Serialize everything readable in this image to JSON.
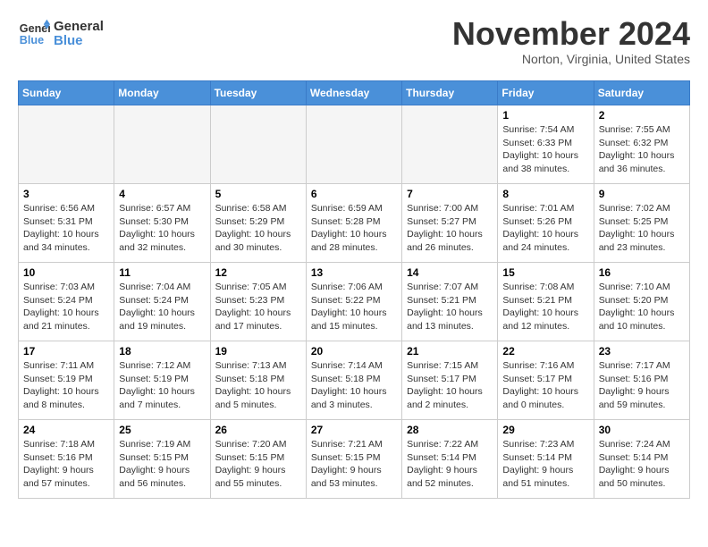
{
  "logo": {
    "line1": "General",
    "line2": "Blue"
  },
  "title": "November 2024",
  "location": "Norton, Virginia, United States",
  "days_header": [
    "Sunday",
    "Monday",
    "Tuesday",
    "Wednesday",
    "Thursday",
    "Friday",
    "Saturday"
  ],
  "weeks": [
    [
      {
        "num": "",
        "info": ""
      },
      {
        "num": "",
        "info": ""
      },
      {
        "num": "",
        "info": ""
      },
      {
        "num": "",
        "info": ""
      },
      {
        "num": "",
        "info": ""
      },
      {
        "num": "1",
        "info": "Sunrise: 7:54 AM\nSunset: 6:33 PM\nDaylight: 10 hours\nand 38 minutes."
      },
      {
        "num": "2",
        "info": "Sunrise: 7:55 AM\nSunset: 6:32 PM\nDaylight: 10 hours\nand 36 minutes."
      }
    ],
    [
      {
        "num": "3",
        "info": "Sunrise: 6:56 AM\nSunset: 5:31 PM\nDaylight: 10 hours\nand 34 minutes."
      },
      {
        "num": "4",
        "info": "Sunrise: 6:57 AM\nSunset: 5:30 PM\nDaylight: 10 hours\nand 32 minutes."
      },
      {
        "num": "5",
        "info": "Sunrise: 6:58 AM\nSunset: 5:29 PM\nDaylight: 10 hours\nand 30 minutes."
      },
      {
        "num": "6",
        "info": "Sunrise: 6:59 AM\nSunset: 5:28 PM\nDaylight: 10 hours\nand 28 minutes."
      },
      {
        "num": "7",
        "info": "Sunrise: 7:00 AM\nSunset: 5:27 PM\nDaylight: 10 hours\nand 26 minutes."
      },
      {
        "num": "8",
        "info": "Sunrise: 7:01 AM\nSunset: 5:26 PM\nDaylight: 10 hours\nand 24 minutes."
      },
      {
        "num": "9",
        "info": "Sunrise: 7:02 AM\nSunset: 5:25 PM\nDaylight: 10 hours\nand 23 minutes."
      }
    ],
    [
      {
        "num": "10",
        "info": "Sunrise: 7:03 AM\nSunset: 5:24 PM\nDaylight: 10 hours\nand 21 minutes."
      },
      {
        "num": "11",
        "info": "Sunrise: 7:04 AM\nSunset: 5:24 PM\nDaylight: 10 hours\nand 19 minutes."
      },
      {
        "num": "12",
        "info": "Sunrise: 7:05 AM\nSunset: 5:23 PM\nDaylight: 10 hours\nand 17 minutes."
      },
      {
        "num": "13",
        "info": "Sunrise: 7:06 AM\nSunset: 5:22 PM\nDaylight: 10 hours\nand 15 minutes."
      },
      {
        "num": "14",
        "info": "Sunrise: 7:07 AM\nSunset: 5:21 PM\nDaylight: 10 hours\nand 13 minutes."
      },
      {
        "num": "15",
        "info": "Sunrise: 7:08 AM\nSunset: 5:21 PM\nDaylight: 10 hours\nand 12 minutes."
      },
      {
        "num": "16",
        "info": "Sunrise: 7:10 AM\nSunset: 5:20 PM\nDaylight: 10 hours\nand 10 minutes."
      }
    ],
    [
      {
        "num": "17",
        "info": "Sunrise: 7:11 AM\nSunset: 5:19 PM\nDaylight: 10 hours\nand 8 minutes."
      },
      {
        "num": "18",
        "info": "Sunrise: 7:12 AM\nSunset: 5:19 PM\nDaylight: 10 hours\nand 7 minutes."
      },
      {
        "num": "19",
        "info": "Sunrise: 7:13 AM\nSunset: 5:18 PM\nDaylight: 10 hours\nand 5 minutes."
      },
      {
        "num": "20",
        "info": "Sunrise: 7:14 AM\nSunset: 5:18 PM\nDaylight: 10 hours\nand 3 minutes."
      },
      {
        "num": "21",
        "info": "Sunrise: 7:15 AM\nSunset: 5:17 PM\nDaylight: 10 hours\nand 2 minutes."
      },
      {
        "num": "22",
        "info": "Sunrise: 7:16 AM\nSunset: 5:17 PM\nDaylight: 10 hours\nand 0 minutes."
      },
      {
        "num": "23",
        "info": "Sunrise: 7:17 AM\nSunset: 5:16 PM\nDaylight: 9 hours\nand 59 minutes."
      }
    ],
    [
      {
        "num": "24",
        "info": "Sunrise: 7:18 AM\nSunset: 5:16 PM\nDaylight: 9 hours\nand 57 minutes."
      },
      {
        "num": "25",
        "info": "Sunrise: 7:19 AM\nSunset: 5:15 PM\nDaylight: 9 hours\nand 56 minutes."
      },
      {
        "num": "26",
        "info": "Sunrise: 7:20 AM\nSunset: 5:15 PM\nDaylight: 9 hours\nand 55 minutes."
      },
      {
        "num": "27",
        "info": "Sunrise: 7:21 AM\nSunset: 5:15 PM\nDaylight: 9 hours\nand 53 minutes."
      },
      {
        "num": "28",
        "info": "Sunrise: 7:22 AM\nSunset: 5:14 PM\nDaylight: 9 hours\nand 52 minutes."
      },
      {
        "num": "29",
        "info": "Sunrise: 7:23 AM\nSunset: 5:14 PM\nDaylight: 9 hours\nand 51 minutes."
      },
      {
        "num": "30",
        "info": "Sunrise: 7:24 AM\nSunset: 5:14 PM\nDaylight: 9 hours\nand 50 minutes."
      }
    ]
  ]
}
